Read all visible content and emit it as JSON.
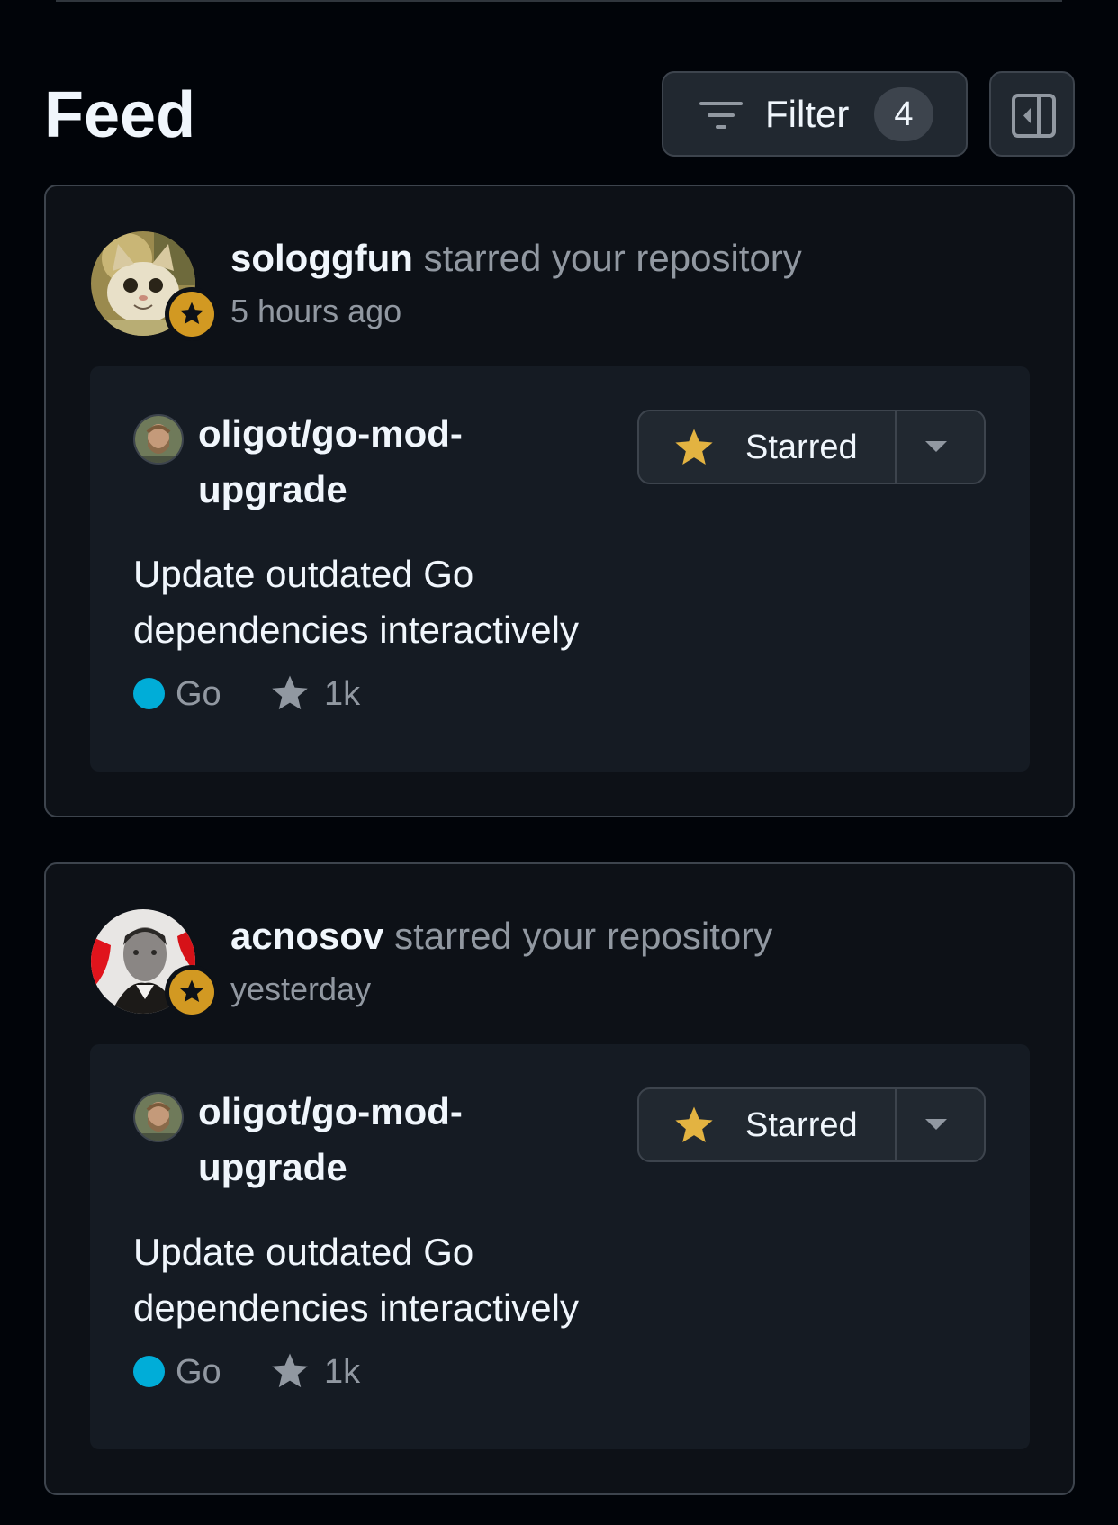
{
  "header": {
    "title": "Feed",
    "filter_label": "Filter",
    "filter_count": "4"
  },
  "feed": [
    {
      "actor": "sologgfun",
      "action": "starred your repository",
      "time": "5 hours ago",
      "repo": {
        "name": "oligot/go-mod-upgrade",
        "description": "Update outdated Go dependencies interactively",
        "star_button_label": "Starred",
        "language": "Go",
        "language_color": "#00add8",
        "stars": "1k"
      }
    },
    {
      "actor": "acnosov",
      "action": "starred your repository",
      "time": "yesterday",
      "repo": {
        "name": "oligot/go-mod-upgrade",
        "description": "Update outdated Go dependencies interactively",
        "star_button_label": "Starred",
        "language": "Go",
        "language_color": "#00add8",
        "stars": "1k"
      }
    }
  ],
  "colors": {
    "background": "#010409",
    "card": "#0d1117",
    "repo_box": "#151b23",
    "border": "#3d444d",
    "star_accent": "#d29922",
    "muted_text": "#9198a1"
  }
}
